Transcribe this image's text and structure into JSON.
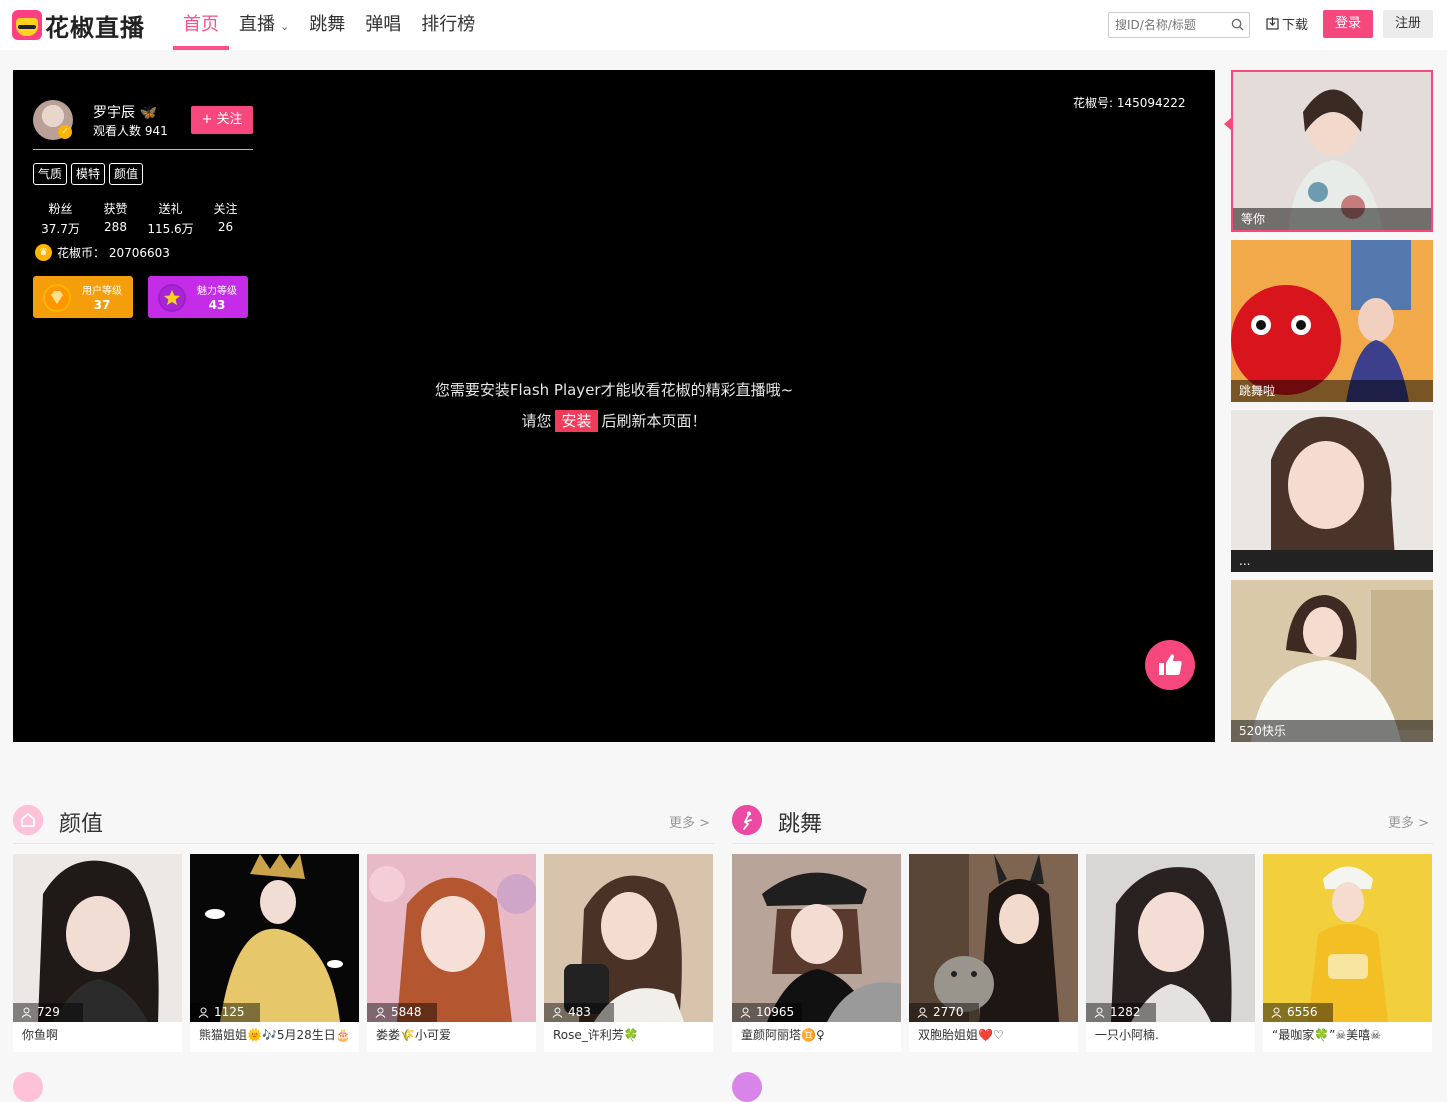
{
  "header": {
    "logo_text": "花椒直播",
    "nav": [
      {
        "label": "首页",
        "active": true
      },
      {
        "label": "直播",
        "active": false,
        "has_dropdown": true
      },
      {
        "label": "跳舞",
        "active": false
      },
      {
        "label": "弹唱",
        "active": false
      },
      {
        "label": "排行榜",
        "active": false
      }
    ],
    "search_placeholder": "搜ID/名称/标题",
    "download_label": "下载",
    "login_label": "登录",
    "register_label": "注册"
  },
  "player": {
    "anchor_name": "罗宇辰 🦋",
    "viewers_text": "观看人数 941",
    "follow_label": "+ 关注",
    "tags": [
      "气质",
      "模特",
      "颜值"
    ],
    "stats": [
      {
        "label": "粉丝",
        "value": "37.7万"
      },
      {
        "label": "获赞",
        "value": "288"
      },
      {
        "label": "送礼",
        "value": "115.6万"
      },
      {
        "label": "关注",
        "value": "26"
      }
    ],
    "coins_text": "花椒币： 20706603",
    "user_level": {
      "label": "用户等级",
      "value": "37"
    },
    "charm_level": {
      "label": "魅力等级",
      "value": "43"
    },
    "room_number": "花椒号: 145094222",
    "flash_line1": "您需要安装Flash Player才能收看花椒的精彩直播哦~",
    "flash_line2_prefix": "请您",
    "install_label": "安装",
    "flash_line2_suffix": "后刷新本页面！"
  },
  "side_rooms": [
    {
      "caption": "等你",
      "active": true
    },
    {
      "caption": "跳舞啦",
      "active": false
    },
    {
      "caption": "...",
      "active": false
    },
    {
      "caption": "520快乐",
      "active": false
    }
  ],
  "sections": [
    {
      "title": "颜值",
      "more": "更多 >",
      "cards": [
        {
          "viewers": "729",
          "name": "你鱼啊"
        },
        {
          "viewers": "1125",
          "name": "熊猫姐姐🌞🎶5月28生日🎂"
        },
        {
          "viewers": "5848",
          "name": "娄娄🌾小可爱"
        },
        {
          "viewers": "483",
          "name": "Rose_许利芳🍀"
        }
      ]
    },
    {
      "title": "跳舞",
      "more": "更多 >",
      "cards": [
        {
          "viewers": "10965",
          "name": "童颜阿丽塔♊️♀"
        },
        {
          "viewers": "2770",
          "name": "双胞胎姐姐❤️♡"
        },
        {
          "viewers": "1282",
          "name": "一只小阿楠."
        },
        {
          "viewers": "6556",
          "name": "“最咖家🍀”☠美嘻☠"
        }
      ]
    }
  ],
  "colors": {
    "brand_pink": "#f7487e",
    "nav_active": "#ff4f8b",
    "user_level_bg": "#f59e0b",
    "charm_level_bg": "#c52ce8"
  }
}
